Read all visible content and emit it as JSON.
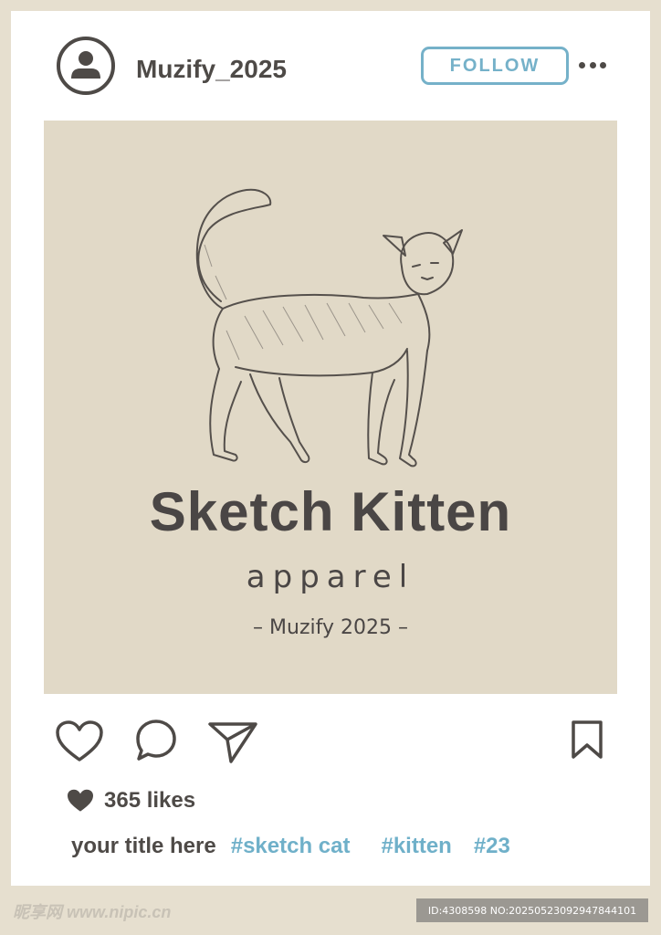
{
  "header": {
    "username": "Muzify_2025",
    "follow_label": "FOLLOW",
    "avatar_icon": "user-icon",
    "more_icon": "more-horizontal-icon"
  },
  "post": {
    "title": "Sketch Kitten",
    "subtitle": "apparel",
    "brand": "– Muzify 2025 –",
    "image_subject": "cat-sketch"
  },
  "actions": {
    "like_icon": "heart-icon",
    "comment_icon": "comment-icon",
    "share_icon": "send-icon",
    "save_icon": "bookmark-icon"
  },
  "likes": {
    "icon": "heart-filled-icon",
    "text": "365 likes"
  },
  "caption": {
    "title": "your title here",
    "tags": [
      "#sketch cat",
      "#kitten",
      "#23"
    ]
  },
  "watermark": {
    "left": "昵享网 www.nipic.cn",
    "right": "ID:4308598 NO:20250523092947844101"
  },
  "colors": {
    "background": "#e6dfcf",
    "card": "#ffffff",
    "post_background": "#e1d9c7",
    "text_dark": "#4e4a47",
    "accent": "#75b1c9"
  }
}
